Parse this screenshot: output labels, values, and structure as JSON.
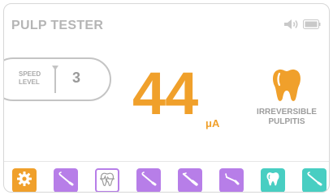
{
  "header": {
    "title": "PULP TESTER",
    "icons": [
      "speaker-icon",
      "battery-icon"
    ]
  },
  "speed": {
    "label_line1": "SPEED",
    "label_line2": "LEVEL",
    "value": "3"
  },
  "reading": {
    "value": "44",
    "unit": "μA"
  },
  "result": {
    "icon": "tooth-icon",
    "line1": "IRREVERSIBLE",
    "line2": "PULPITIS"
  },
  "toolbar": {
    "items": [
      {
        "icon": "settings-gear-icon",
        "color": "#f0a02b"
      },
      {
        "icon": "dental-probe-icon",
        "color": "#b77ee8"
      },
      {
        "icon": "tooth-signal-icon",
        "color": "#b77ee8",
        "selected": true
      },
      {
        "icon": "dental-probe-icon",
        "color": "#b77ee8"
      },
      {
        "icon": "dental-probe-icon",
        "color": "#b77ee8"
      },
      {
        "icon": "dental-probe-icon",
        "color": "#b77ee8"
      },
      {
        "icon": "tooth-icon",
        "color": "#48cec2"
      },
      {
        "icon": "dental-probe-icon",
        "color": "#48cec2"
      }
    ]
  },
  "colors": {
    "accent_orange": "#f0a02b",
    "purple": "#b77ee8",
    "teal": "#48cec2",
    "text_gray": "#b5b5b5"
  }
}
